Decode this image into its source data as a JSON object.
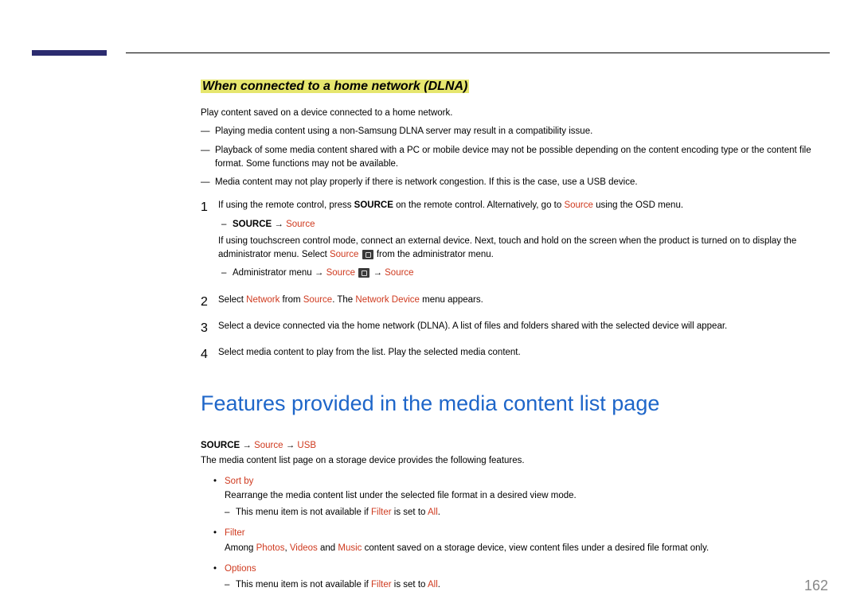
{
  "section_heading": "When connected to a home network (DLNA)",
  "intro": "Play content saved on a device connected to a home network.",
  "dashes": [
    "Playing media content using a non-Samsung DLNA server may result in a compatibility issue.",
    "Playback of some media content shared with a PC or mobile device may not be possible depending on the content encoding type or the content file format. Some functions may not be available.",
    "Media content may not play properly if there is network congestion. If this is the case, use a USB device."
  ],
  "step1": {
    "pre": "If using the remote control, press ",
    "bold1": "SOURCE",
    "mid1": " on the remote control. Alternatively, go to ",
    "red1": "Source",
    "end1": " using the OSD menu.",
    "sub1_bold": "SOURCE",
    "sub1_arrow": " → ",
    "sub1_red": "Source",
    "para2_a": "If using touchscreen control mode, connect an external device. Next, touch and hold on the screen when the product is turned on to display the administrator menu. Select ",
    "para2_red": "Source",
    "para2_b": " from the administrator menu.",
    "sub2_a": "Administrator menu → ",
    "sub2_red1": "Source",
    "sub2_b": " → ",
    "sub2_red2": "Source"
  },
  "step2": {
    "a": "Select ",
    "r1": "Network",
    "b": " from ",
    "r2": "Source",
    "c": ". The ",
    "r3": "Network Device",
    "d": " menu appears."
  },
  "step3": "Select a device connected via the home network (DLNA). A list of files and folders shared with the selected device will appear.",
  "step4": "Select media content to play from the list. Play the selected media content.",
  "main_heading": "Features provided in the media content list page",
  "path": {
    "bold": "SOURCE",
    "a1": " → ",
    "r1": "Source",
    "a2": " → ",
    "r2": "USB"
  },
  "features_intro": "The media content list page on a storage device provides the following features.",
  "feat1": {
    "title": "Sort by",
    "desc": "Rearrange the media content list under the selected file format in a desired view mode.",
    "note_a": "This menu item is not available if ",
    "note_r": "Filter",
    "note_b": " is set to ",
    "note_r2": "All",
    "note_c": "."
  },
  "feat2": {
    "title": "Filter",
    "a": "Among ",
    "r1": "Photos",
    "b": ", ",
    "r2": "Videos",
    "c": " and ",
    "r3": "Music",
    "d": " content saved on a storage device, view content files under a desired file format only."
  },
  "feat3": {
    "title": "Options",
    "note_a": "This menu item is not available if ",
    "note_r": "Filter",
    "note_b": " is set to ",
    "note_r2": "All",
    "note_c": "."
  },
  "page_number": "162"
}
